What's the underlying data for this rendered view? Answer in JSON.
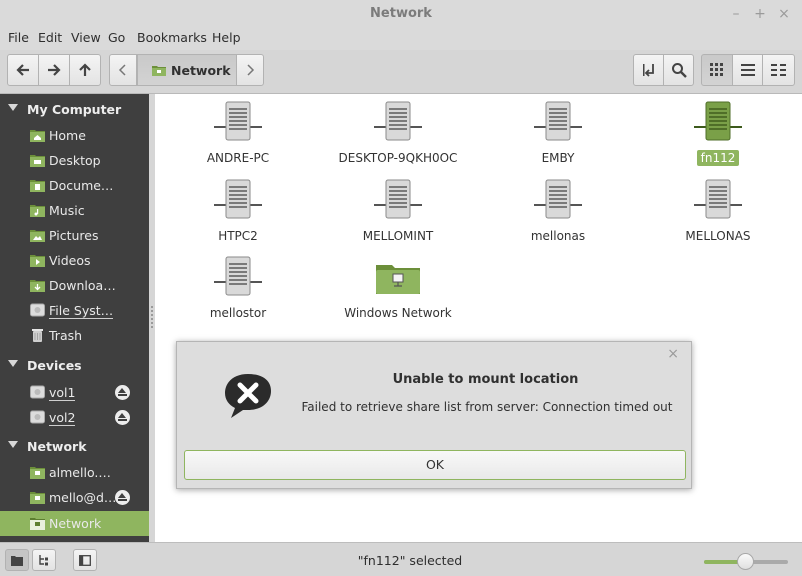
{
  "window": {
    "title": "Network",
    "minimize": "–",
    "maximize": "+",
    "close": "×"
  },
  "menu": [
    "File",
    "Edit",
    "View",
    "Go",
    "Bookmarks",
    "Help"
  ],
  "toolbar": {
    "location": "Network"
  },
  "sidebar": {
    "sections": [
      {
        "title": "My Computer",
        "items": [
          "Home",
          "Desktop",
          "Docume…",
          "Music",
          "Pictures",
          "Videos",
          "Downloa…",
          "File Syst…",
          "Trash"
        ]
      },
      {
        "title": "Devices",
        "items": [
          "vol1",
          "vol2"
        ]
      },
      {
        "title": "Network",
        "items": [
          "almello.…",
          "mello@d…",
          "Network"
        ]
      }
    ]
  },
  "files": [
    "ANDRE-PC",
    "DESKTOP-9QKH0OC",
    "EMBY",
    "fn112",
    "HTPC2",
    "MELLOMINT",
    "mellonas",
    "MELLONAS",
    "mellostor",
    "Windows Network"
  ],
  "selected_file": "fn112",
  "dialog": {
    "title": "Unable to mount location",
    "message": "Failed to retrieve share list from server: Connection timed out",
    "ok": "OK",
    "close": "×"
  },
  "status": {
    "text": "\"fn112\" selected",
    "zoom_level": 0.5
  },
  "colors": {
    "accent": "#8fb55f",
    "sidebar_bg": "#3f3f3f"
  }
}
